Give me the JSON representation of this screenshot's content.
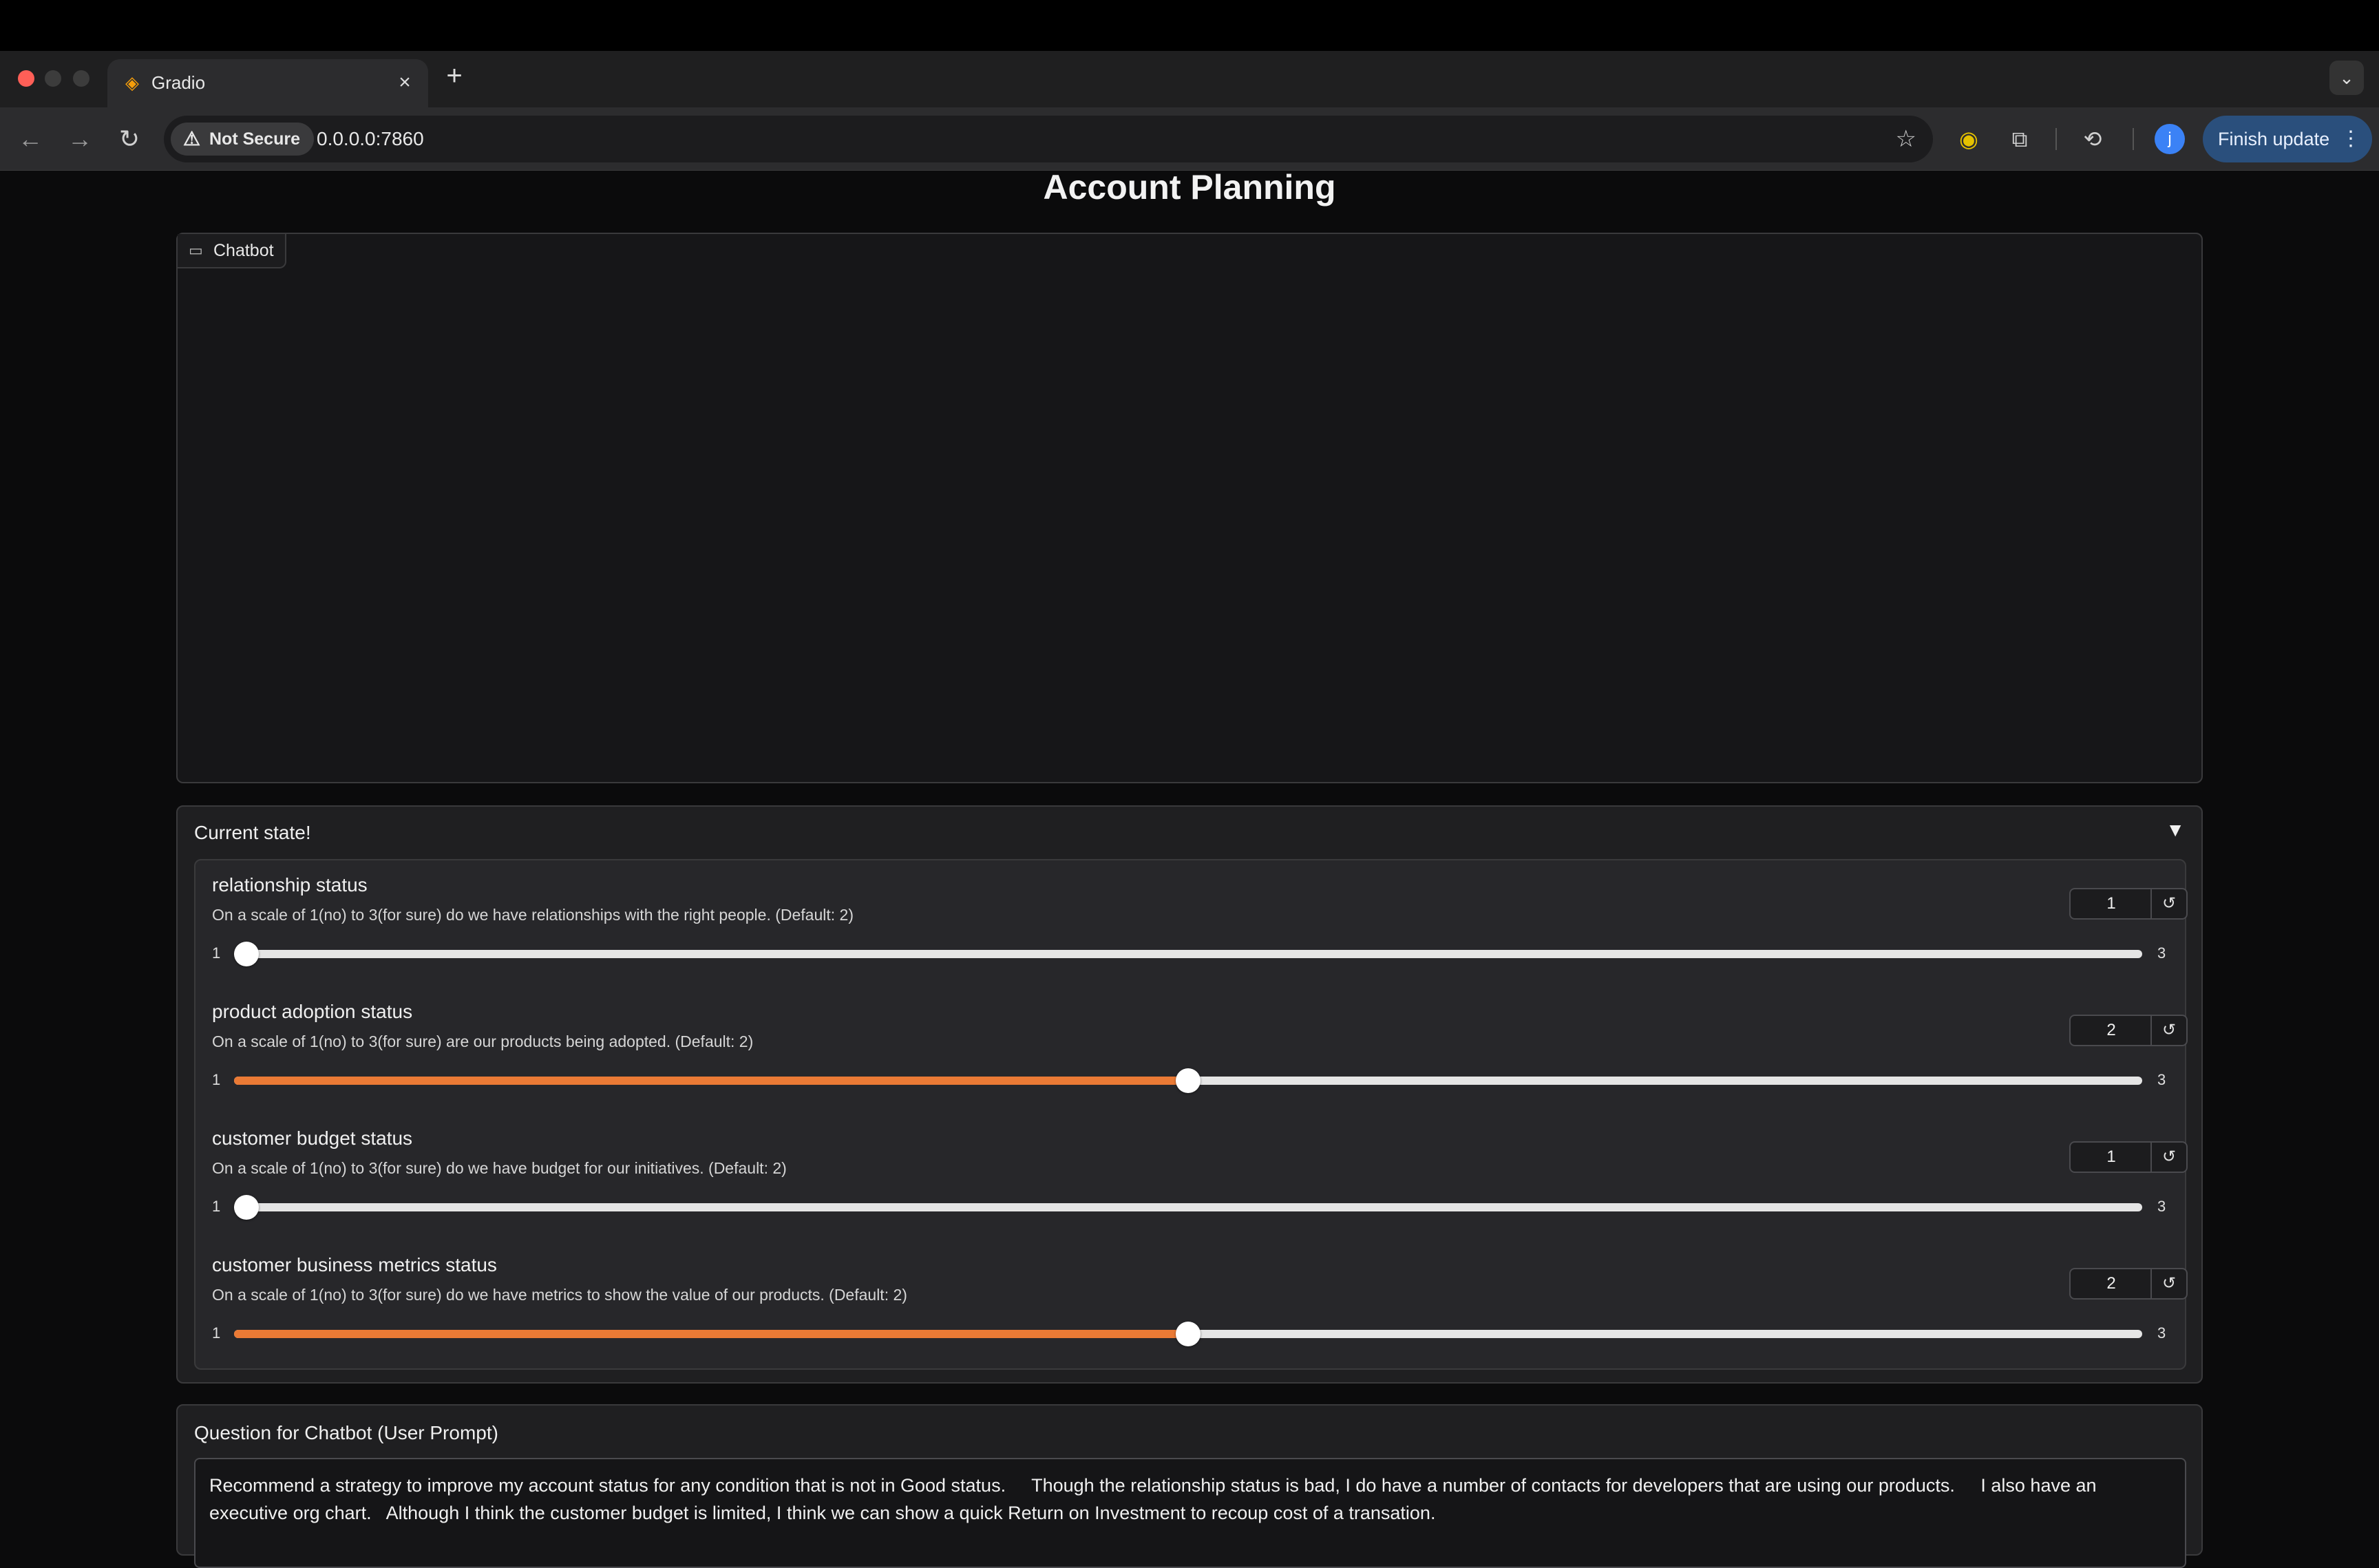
{
  "browser": {
    "tab_title": "Gradio",
    "security_label": "Not Secure",
    "url": "0.0.0.0:7860",
    "profile_initial": "j",
    "finish_update_label": "Finish update"
  },
  "page": {
    "title": "Account Planning"
  },
  "chatbot": {
    "label": "Chatbot"
  },
  "state_panel": {
    "title": "Current state!",
    "toggle": "▼",
    "sliders": [
      {
        "label": "relationship status",
        "info": "On a scale of 1(no) to 3(for sure) do we have relationships with the right people. (Default: 2)",
        "value": "1",
        "min": "1",
        "max": "3",
        "fraction": 0
      },
      {
        "label": "product adoption status",
        "info": "On a scale of 1(no) to 3(for sure) are our products being adopted. (Default: 2)",
        "value": "2",
        "min": "1",
        "max": "3",
        "fraction": 0.5
      },
      {
        "label": "customer budget status",
        "info": "On a scale of 1(no) to 3(for sure) do we have budget for our initiatives. (Default: 2)",
        "value": "1",
        "min": "1",
        "max": "3",
        "fraction": 0
      },
      {
        "label": "customer business metrics status",
        "info": "On a scale of 1(no) to 3(for sure) do we have metrics to show the value of our products. (Default: 2)",
        "value": "2",
        "min": "1",
        "max": "3",
        "fraction": 0.5
      }
    ]
  },
  "prompt": {
    "label": "Question for Chatbot (User Prompt)",
    "text": "Recommend a strategy to improve my account status for any condition that is not in Good status.     Though the relationship status is bad, I do have a number of contacts for developers that are using our products.     I also have an executive org chart.   Although I think the customer budget is limited, I think we can show a quick Return on Investment to recoup cost of a transation."
  },
  "icons": {
    "back": "arrow-left-icon",
    "forward": "arrow-right-icon",
    "reload": "reload-icon",
    "warning": "warning-icon",
    "star": "star-icon",
    "extension": "puzzle-icon",
    "history": "history-icon",
    "reset": "reset-icon",
    "chat": "chat-icon"
  },
  "colors": {
    "accent": "#ea7a35",
    "finish_button": "#2a4f7c",
    "close_dot": "#ff5f57"
  }
}
